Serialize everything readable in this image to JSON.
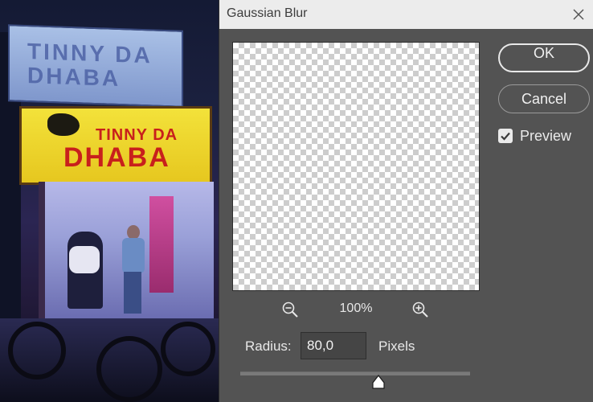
{
  "dialog": {
    "title": "Gaussian Blur",
    "ok_label": "OK",
    "cancel_label": "Cancel",
    "preview_label": "Preview",
    "preview_checked": true,
    "zoom_level": "100%",
    "radius_label": "Radius:",
    "radius_value": "80,0",
    "units_label": "Pixels",
    "slider_position_fraction": 0.6
  },
  "background_photo": {
    "sign_upper_text": [
      "TINNY DA",
      "DHABA"
    ],
    "sign_main_line1": "TINNY DA",
    "sign_main_line2": "DHABA"
  },
  "colors": {
    "dialog_bg": "#535353",
    "titlebar_bg": "#ececec",
    "text_light": "#e8e8e8",
    "sign_yellow": "#f3e23a",
    "sign_red": "#c8201c"
  },
  "icons": {
    "close": "close-icon",
    "zoom_out": "zoom-out-icon",
    "zoom_in": "zoom-in-icon",
    "checkbox": "checkmark-icon",
    "slider_thumb": "triangle-up-icon"
  }
}
